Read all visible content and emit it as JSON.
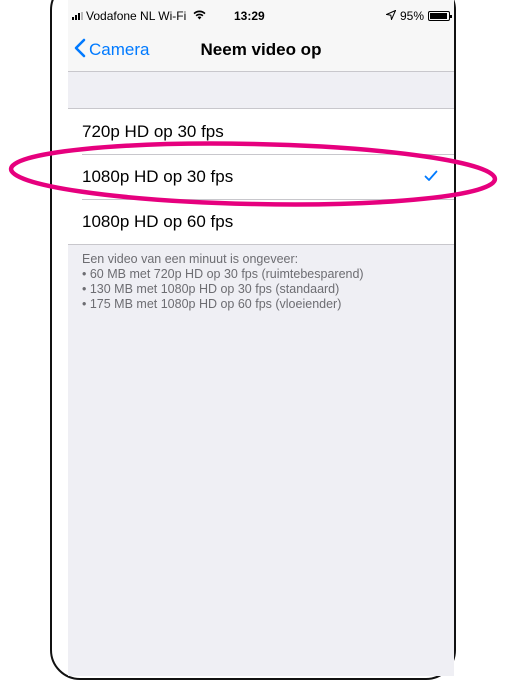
{
  "status": {
    "carrier": "Vodafone NL Wi-Fi",
    "time": "13:29",
    "battery": "95%",
    "battery_level": 0.95
  },
  "nav": {
    "back_label": "Camera",
    "title": "Neem video op"
  },
  "options": [
    {
      "label": "720p HD op 30 fps",
      "selected": false
    },
    {
      "label": "1080p HD op 30 fps",
      "selected": true
    },
    {
      "label": "1080p HD op 60 fps",
      "selected": false
    }
  ],
  "footer": [
    "Een video van een minuut is ongeveer:",
    "• 60 MB met 720p HD op 30 fps (ruimtebesparend)",
    "• 130 MB met 1080p HD op 30 fps (standaard)",
    "• 175 MB met 1080p HD op 60 fps (vloeiender)"
  ],
  "colors": {
    "accent": "#007aff",
    "highlight": "#e6007e"
  },
  "icons": {
    "back": "chevron-left-icon",
    "check": "checkmark-icon",
    "wifi": "wifi-icon",
    "signal": "signal-icon",
    "location": "location-arrow-icon",
    "battery": "battery-icon"
  }
}
